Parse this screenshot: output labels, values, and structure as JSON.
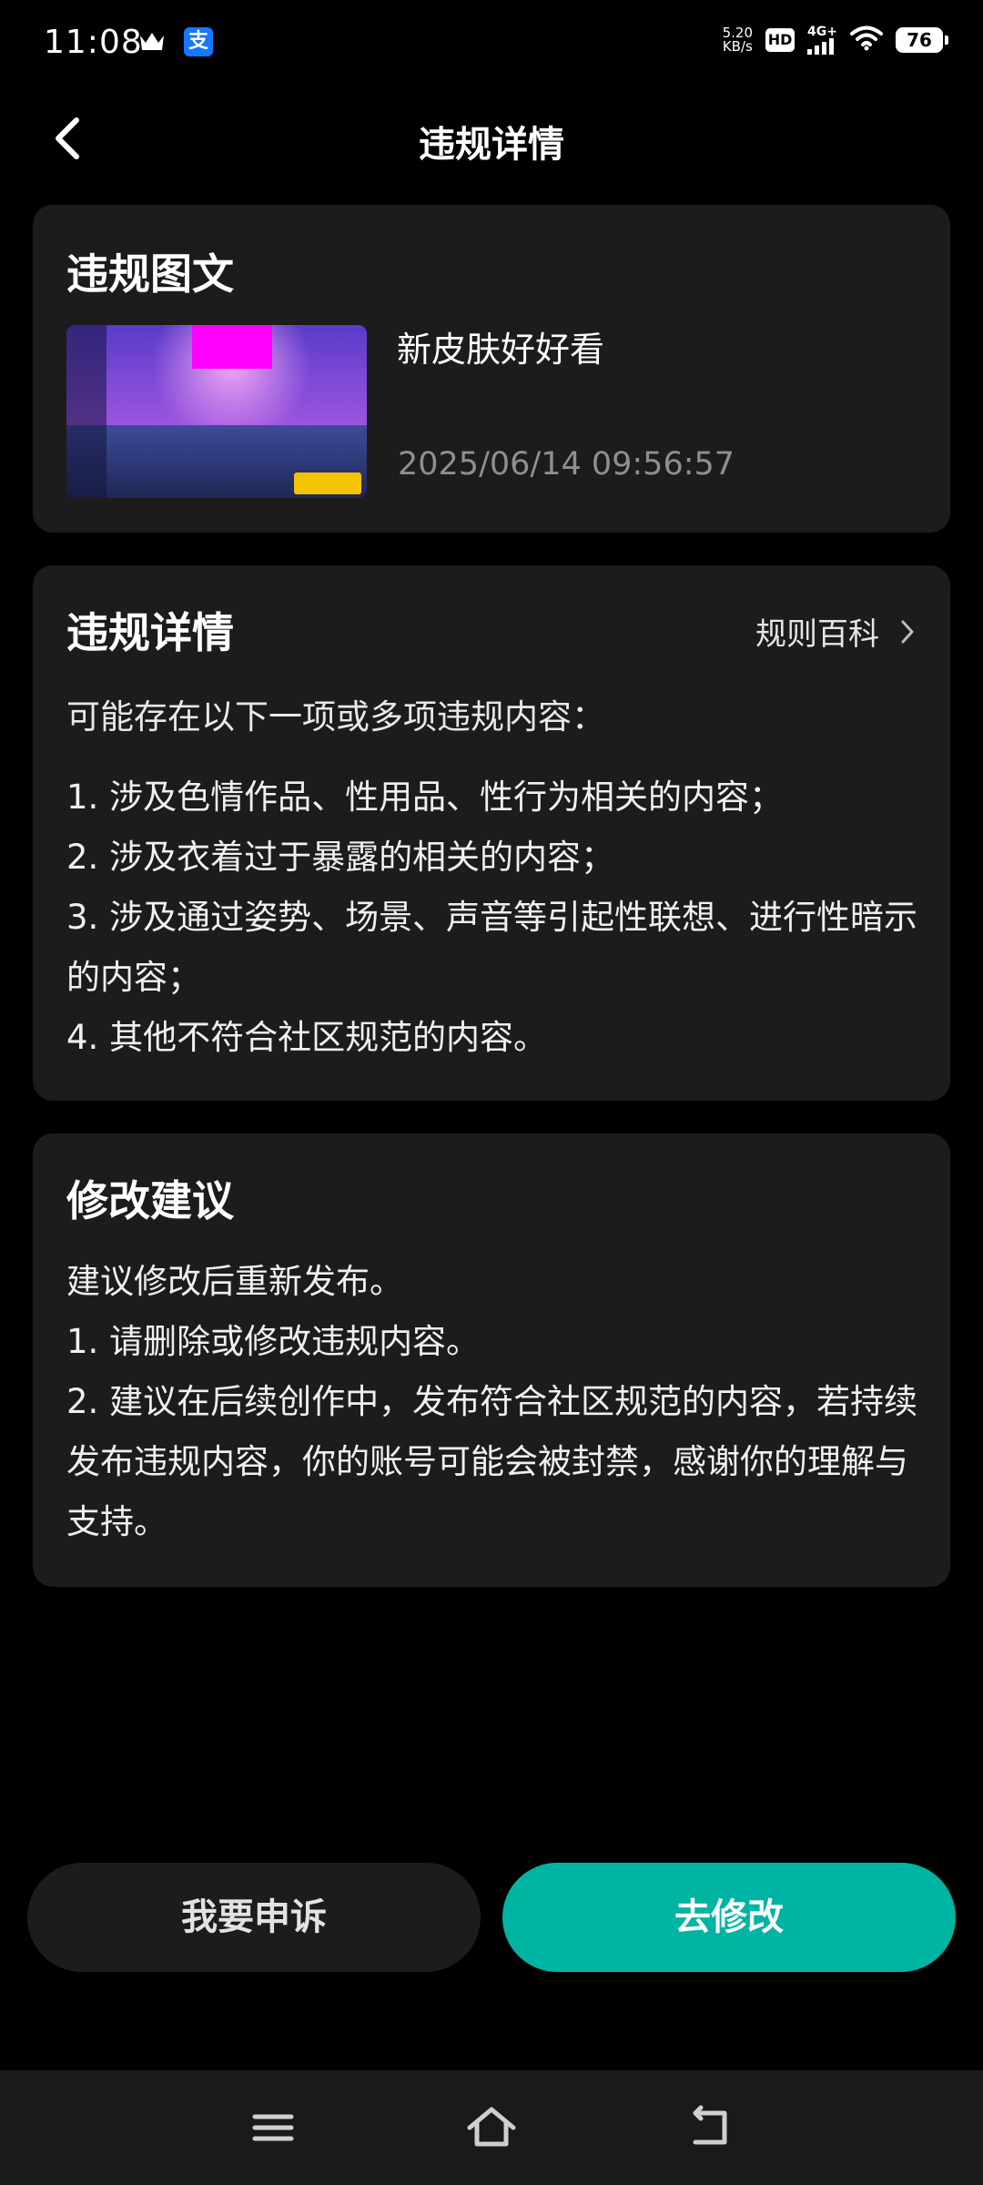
{
  "status_bar": {
    "time": "11:08",
    "net_speed_value": "5.20",
    "net_speed_unit": "KB/s",
    "hd_label": "HD",
    "network_type": "4G+",
    "battery": "76"
  },
  "header": {
    "title": "违规详情"
  },
  "violation_post": {
    "title": "违规图文",
    "text": "新皮肤好好看",
    "time": "2025/06/14 09:56:57"
  },
  "violation_detail": {
    "title": "违规详情",
    "rules_link": "规则百科",
    "intro": "可能存在以下一项或多项违规内容：",
    "items": [
      "1. 涉及色情作品、性用品、性行为相关的内容；",
      "2. 涉及衣着过于暴露的相关的内容；",
      "3. 涉及通过姿势、场景、声音等引起性联想、进行性暗示的内容；",
      "4. 其他不符合社区规范的内容。"
    ]
  },
  "suggestion": {
    "title": "修改建议",
    "lines": [
      "建议修改后重新发布。",
      "1. 请删除或修改违规内容。",
      "2. 建议在后续创作中，发布符合社区规范的内容，若持续发布违规内容，你的账号可能会被封禁，感谢你的理解与支持。"
    ]
  },
  "actions": {
    "appeal": "我要申诉",
    "modify": "去修改"
  },
  "colors": {
    "background": "#000000",
    "card": "#1c1c1c",
    "accent": "#00b4a3",
    "muted_text": "#8f8f8f"
  },
  "icons": {
    "back": "back-chevron-icon",
    "rules_link": "chevron-right-icon",
    "nav_menu": "menu-icon",
    "nav_home": "home-icon",
    "nav_back": "back-arrow-icon"
  }
}
